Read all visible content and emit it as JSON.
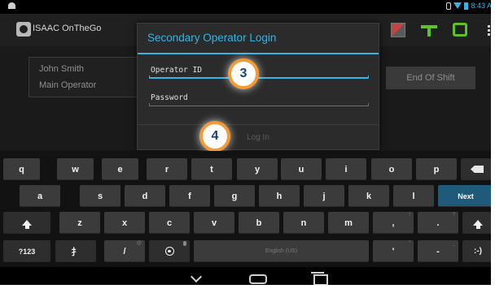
{
  "status_bar": {
    "time": "8:43 A"
  },
  "app": {
    "title": "ISAAC OnTheGo"
  },
  "background": {
    "operator_name": "John Smith",
    "operator_role": "Main Operator",
    "end_shift_label": "End Of Shift"
  },
  "dialog": {
    "title": "Secondary Operator Login",
    "operator_id_placeholder": "Operator ID",
    "password_placeholder": "Password",
    "login_label": "Log In"
  },
  "markers": {
    "three": "3",
    "four": "4"
  },
  "keyboard": {
    "row1": [
      "q",
      "w",
      "e",
      "r",
      "t",
      "y",
      "u",
      "i",
      "o",
      "p"
    ],
    "row2": [
      "a",
      "s",
      "d",
      "f",
      "g",
      "h",
      "j",
      "k",
      "l"
    ],
    "row2_action": "Next",
    "row3": [
      "z",
      "x",
      "c",
      "v",
      "b",
      "n",
      "m",
      ",",
      "."
    ],
    "row3_hints": [
      "!",
      "?"
    ],
    "row4": {
      "symbols": "?123",
      "handwriting": "扌",
      "slash": "/",
      "at_hint": "@",
      "space": "English (US)",
      "apostrophe": "'",
      "quote_hint": "\"",
      "dash": "-",
      "underscore_hint": "_",
      "smiley": ":-)"
    }
  },
  "colors": {
    "accent": "#33b5e5",
    "marker_ring": "#f39b35",
    "marker_text": "#1c3f7a",
    "status_green": "#5cc22c"
  },
  "icons": [
    "app-logo-icon",
    "flag-icon",
    "network-icon",
    "bus-icon",
    "overflow-menu-icon",
    "backspace-icon",
    "shift-icon",
    "globe-icon",
    "back-icon",
    "home-icon",
    "recents-icon"
  ]
}
